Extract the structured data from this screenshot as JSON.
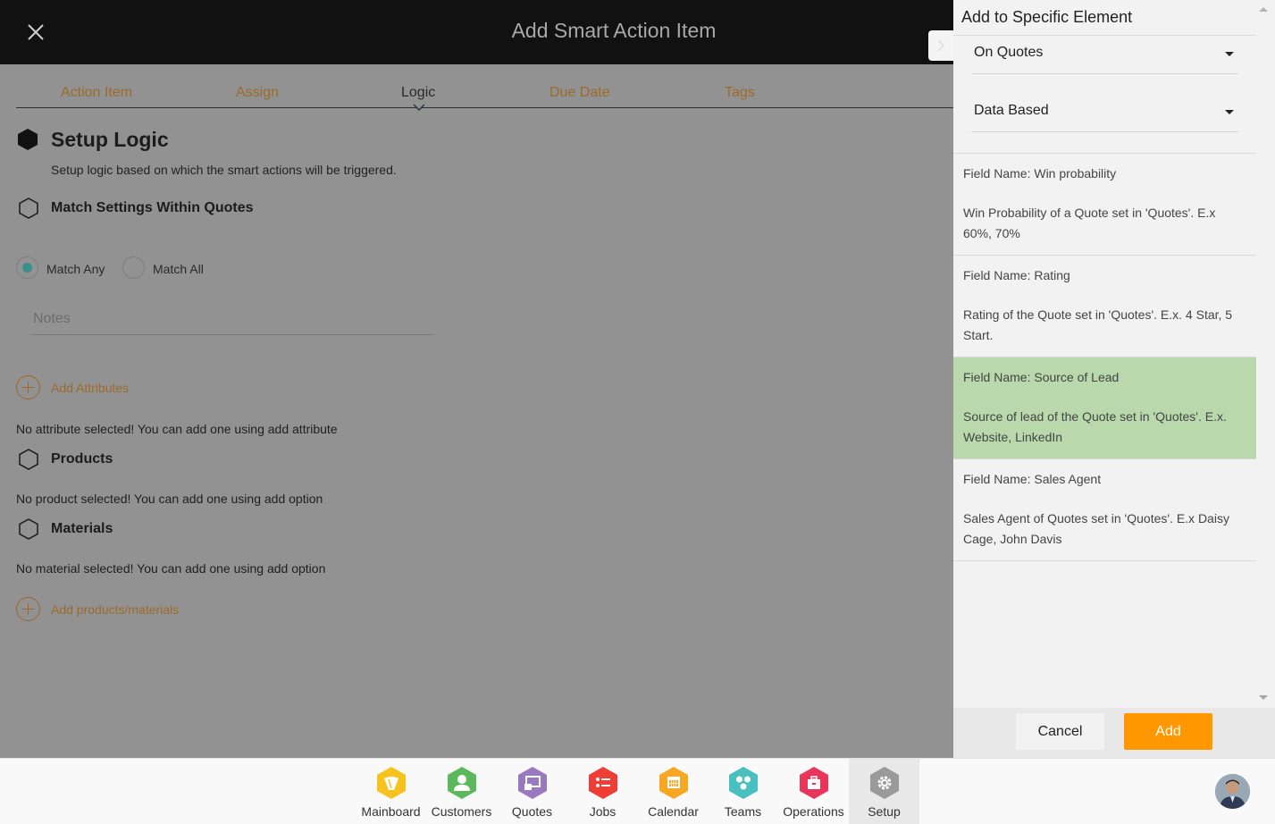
{
  "header": {
    "title": "Add Smart Action Item",
    "close_icon": "close-icon"
  },
  "tabs": [
    {
      "label": "Action Item",
      "active": false
    },
    {
      "label": "Assign",
      "active": false
    },
    {
      "label": "Logic",
      "active": true
    },
    {
      "label": "Due Date",
      "active": false
    },
    {
      "label": "Tags",
      "active": false
    }
  ],
  "setup": {
    "title": "Setup Logic",
    "subtitle": "Setup logic based on which the smart actions will be triggered.",
    "match_title": "Match Settings Within Quotes",
    "radio_options": [
      {
        "label": "Match Any",
        "checked": true
      },
      {
        "label": "Match All",
        "checked": false
      }
    ],
    "notes_placeholder": "Notes",
    "notes_value": "",
    "add_attributes_label": "Add Attributes",
    "no_attribute_text": "No attribute selected! You can add one using add attribute",
    "products_title": "Products",
    "no_product_text": "No product selected! You can add one using add option",
    "materials_title": "Materials",
    "no_material_text": "No material selected! You can add one using add option",
    "add_products_label": "Add products/materials"
  },
  "panel": {
    "title": "Add to Specific Element",
    "select_element": "On Quotes",
    "select_type": "Data Based",
    "items": [
      {
        "field_name": "Field Name: Win probability",
        "description": "Win Probability of a Quote set in 'Quotes'. E.x 60%, 70%",
        "selected": false
      },
      {
        "field_name": "Field Name: Rating",
        "description": "Rating of the Quote set in 'Quotes'. E.x. 4 Star, 5 Start.",
        "selected": false
      },
      {
        "field_name": "Field Name: Source of Lead",
        "description": "Source of lead of the Quote set in 'Quotes'. E.x. Website, LinkedIn",
        "selected": true
      },
      {
        "field_name": "Field Name: Sales Agent",
        "description": "Sales Agent of Quotes set in 'Quotes'. E.x Daisy Cage, John Davis",
        "selected": false
      }
    ],
    "cancel_label": "Cancel",
    "add_label": "Add",
    "selected_color": "#b9d9ac",
    "accent_color": "#ff9700"
  },
  "bottom_nav": [
    {
      "label": "Mainboard",
      "icon": "mainboard-icon",
      "color": "#f7c21d",
      "active": false
    },
    {
      "label": "Customers",
      "icon": "customer-icon",
      "color": "#5cb85c",
      "active": false
    },
    {
      "label": "Quotes",
      "icon": "quotes-icon",
      "color": "#9b79c0",
      "active": false
    },
    {
      "label": "Jobs",
      "icon": "jobs-icon",
      "color": "#ee3e36",
      "active": false
    },
    {
      "label": "Calendar",
      "icon": "calendar-icon",
      "color": "#f7a823",
      "active": false
    },
    {
      "label": "Teams",
      "icon": "teams-icon",
      "color": "#49bfc0",
      "active": false
    },
    {
      "label": "Operations",
      "icon": "operations-icon",
      "color": "#e8365a",
      "active": false
    },
    {
      "label": "Setup",
      "icon": "gear-icon",
      "color": "#9a9a9a",
      "active": true
    }
  ]
}
